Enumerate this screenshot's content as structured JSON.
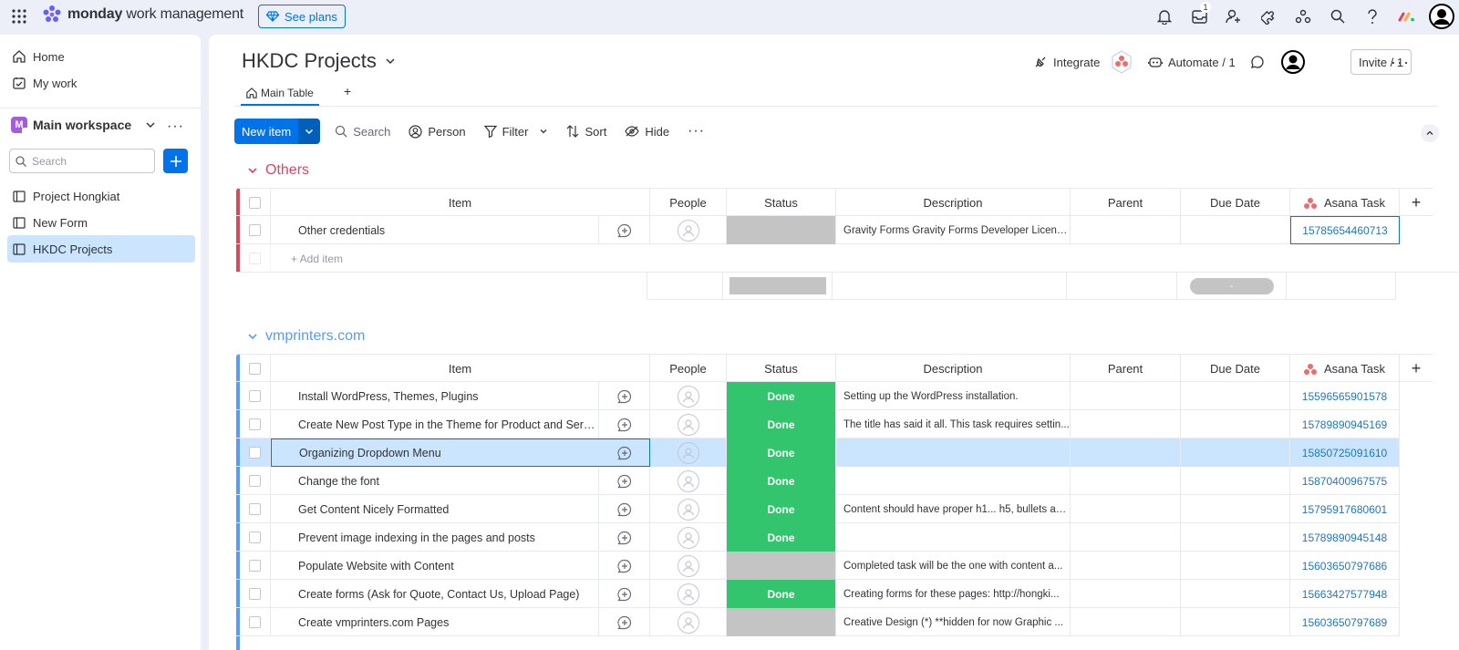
{
  "topbar": {
    "brand_bold": "monday",
    "brand_rest": "work management",
    "see_plans": "See plans",
    "inbox_badge": "1",
    "icons": [
      "bell-icon",
      "inbox-icon",
      "invite-members-icon",
      "apps-icon",
      "integrations-icon",
      "search-icon",
      "help-icon",
      "monday-apps-icon",
      "profile-icon"
    ]
  },
  "sidebar": {
    "home": "Home",
    "my_work": "My work",
    "workspace_initial": "M",
    "workspace": "Main workspace",
    "search_placeholder": "Search",
    "boards": [
      "Project Hongkiat",
      "New Form",
      "HKDC Projects"
    ]
  },
  "board": {
    "title": "HKDC Projects",
    "integrate": "Integrate",
    "automate": "Automate / 1",
    "invite": "Invite / 1",
    "tab": "Main Table",
    "tab_add": "+"
  },
  "toolbar": {
    "new_item": "New item",
    "search": "Search",
    "person": "Person",
    "filter": "Filter",
    "sort": "Sort",
    "hide": "Hide"
  },
  "columns": {
    "item": "Item",
    "people": "People",
    "status": "Status",
    "description": "Description",
    "parent": "Parent",
    "due_date": "Due Date",
    "asana": "Asana Task",
    "add": "+"
  },
  "groups": [
    {
      "name": "Others",
      "color": "#e2445c",
      "add_item": "+ Add item",
      "summary_date": "-",
      "rows": [
        {
          "item": "Other credentials",
          "status": "",
          "description": "Gravity Forms Gravity Forms Developer Licens...",
          "asana": "15785654460713"
        }
      ]
    },
    {
      "name": "vmprinters.com",
      "color": "#579bfc",
      "rows": [
        {
          "item": "Install WordPress, Themes, Plugins",
          "status": "Done",
          "description": "Setting up the WordPress installation.",
          "asana": "15596565901578"
        },
        {
          "item": "Create New Post Type in the Theme for Product and Servi...",
          "status": "Done",
          "description": "The title has said it all. This task requires settin...",
          "asana": "15789890945169"
        },
        {
          "item": "Organizing Dropdown Menu",
          "status": "Done",
          "description": "",
          "asana": "15850725091610"
        },
        {
          "item": "Change the font",
          "status": "Done",
          "description": "",
          "asana": "15870400967575"
        },
        {
          "item": "Get Content Nicely Formatted",
          "status": "Done",
          "description": "Content should have proper h1... h5, bullets an...",
          "asana": "15795917680601"
        },
        {
          "item": "Prevent image indexing in the pages and posts",
          "status": "Done",
          "description": "",
          "asana": "15789890945148"
        },
        {
          "item": "Populate Website with Content",
          "status": "",
          "description": "Completed task will be the one with content a...",
          "asana": "15603650797686"
        },
        {
          "item": "Create forms (Ask for Quote, Contact Us, Upload Page)",
          "status": "Done",
          "description": "Creating forms for these pages: http://hongki...",
          "asana": "15663427577948"
        },
        {
          "item": "Create vmprinters.com Pages",
          "status": "",
          "description": "Creative Design (*) **hidden for now Graphic ...",
          "asana": "15603650797689"
        }
      ]
    }
  ],
  "colors": {
    "accent": "#0073ea",
    "done": "#33c56d",
    "empty_status": "#c4c4c4",
    "link": "#1f76c2",
    "selected_row": "#cce5ff"
  }
}
